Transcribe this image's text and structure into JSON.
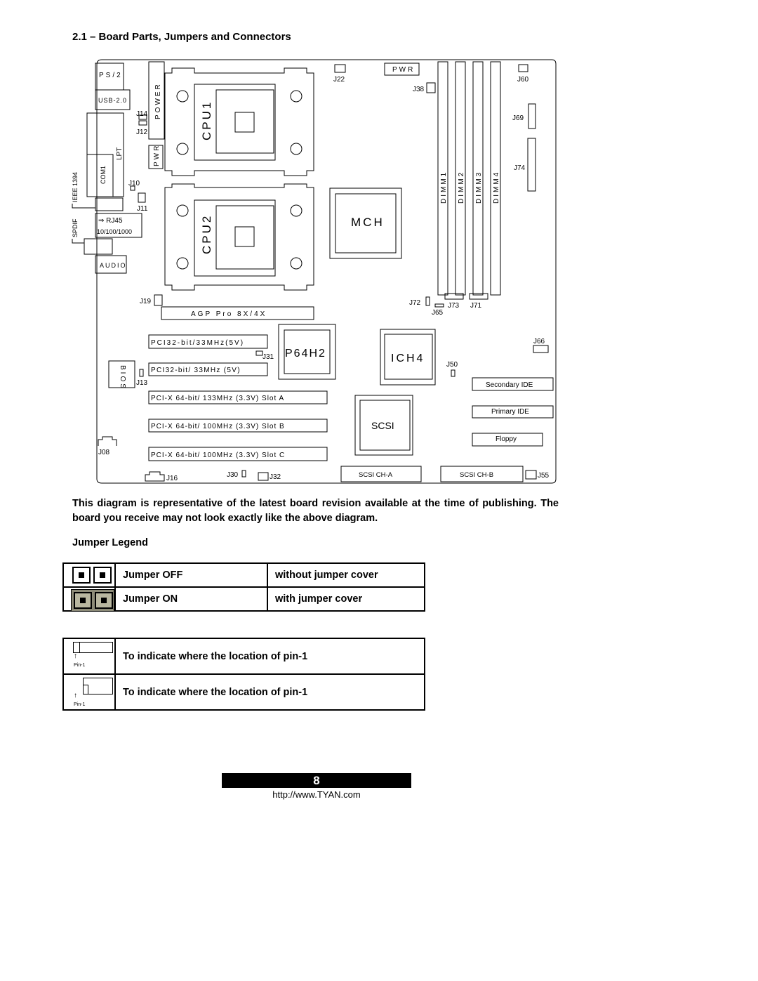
{
  "heading": "2.1 – Board Parts, Jumpers and Connectors",
  "board": {
    "ps2": "PS/2",
    "usb": "USB-2.0",
    "lpt": "LPT",
    "com1": "COM1",
    "ieee1394": "IEEE 1394",
    "rj45": "⇒ RJ45",
    "rj45_speed": "10/100/1000",
    "spdif": "SPDIF",
    "audio": "AUDIO",
    "power": "POWER",
    "pwr_left": "PWR",
    "pwr_top": "PWR",
    "cpu1": "CPU1",
    "cpu2": "CPU2",
    "mch": "MCH",
    "dimm1": "DIMM1",
    "dimm2": "DIMM2",
    "dimm3": "DIMM3",
    "dimm4": "DIMM4",
    "agp": "AGP Pro 8X/4X",
    "pci32_1": "PCI32-bit/33MHz(5V)",
    "pci32_2": "PCI32-bit/ 33MHz (5V)",
    "pcix_a": "PCI-X  64-bit/ 133MHz (3.3V) Slot A",
    "pcix_b": "PCI-X  64-bit/ 100MHz (3.3V) Slot B",
    "pcix_c": "PCI-X  64-bit/ 100MHz (3.3V) Slot C",
    "p64h2": "P64H2",
    "ich4": "ICH4",
    "scsi": "SCSI",
    "bios": "BIOS",
    "secondary_ide": "Secondary IDE",
    "primary_ide": "Primary IDE",
    "floppy": "Floppy",
    "scsi_a": "SCSI CH-A",
    "scsi_b": "SCSI  CH-B",
    "jumpers": {
      "j14": "J14",
      "j12": "J12",
      "j10": "J10",
      "j11": "J11",
      "j22": "J22",
      "j38": "J38",
      "j60": "J60",
      "j69": "J69",
      "j74": "J74",
      "j19": "J19",
      "j72": "J72",
      "j73": "J73",
      "j65": "J65",
      "j71": "J71",
      "j31": "J31",
      "j13": "J13",
      "j50": "J50",
      "j66": "J66",
      "j08": "J08",
      "j16": "J16",
      "j30": "J30",
      "j32": "J32",
      "j55": "J55"
    }
  },
  "paragraph": "This diagram is representative of the latest board revision available at the time of publishing. The board you receive may not look exactly like the above diagram.",
  "legend_title": "Jumper Legend",
  "jumper_table": [
    {
      "state": "Jumper OFF",
      "desc": "without jumper cover"
    },
    {
      "state": "Jumper ON",
      "desc": "with jumper cover"
    }
  ],
  "pin_table": [
    {
      "pin_label": "Pin-1",
      "text": "To indicate where the location of pin-1"
    },
    {
      "pin_label": "Pin-1",
      "text": "To indicate where the location of pin-1"
    }
  ],
  "jumper_on_color": "#8d8b78",
  "page_number": "8",
  "url": "http://www.TYAN.com"
}
